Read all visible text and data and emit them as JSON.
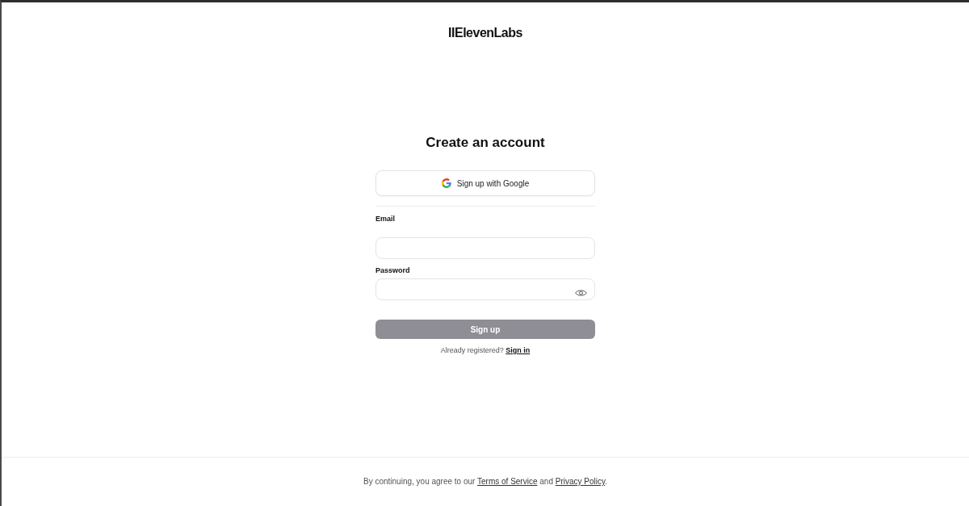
{
  "logo": {
    "text": "IIElevenLabs"
  },
  "form": {
    "title": "Create an account",
    "google_button": {
      "label": "Sign up with Google"
    },
    "fields": [
      {
        "kind": "text",
        "label": "Email"
      },
      {
        "kind": "password",
        "label": "Password"
      }
    ],
    "submit_button": {
      "label": "Sign up",
      "disabled": true
    },
    "signin_prompt": {
      "text": "Already registered?",
      "link": "Sign in"
    }
  },
  "footer": {
    "text_before": "By continuing, you agree to our",
    "terms_link": "Terms of Service",
    "text_middle": "and",
    "privacy_link": "Privacy Policy",
    "text_after": "."
  }
}
